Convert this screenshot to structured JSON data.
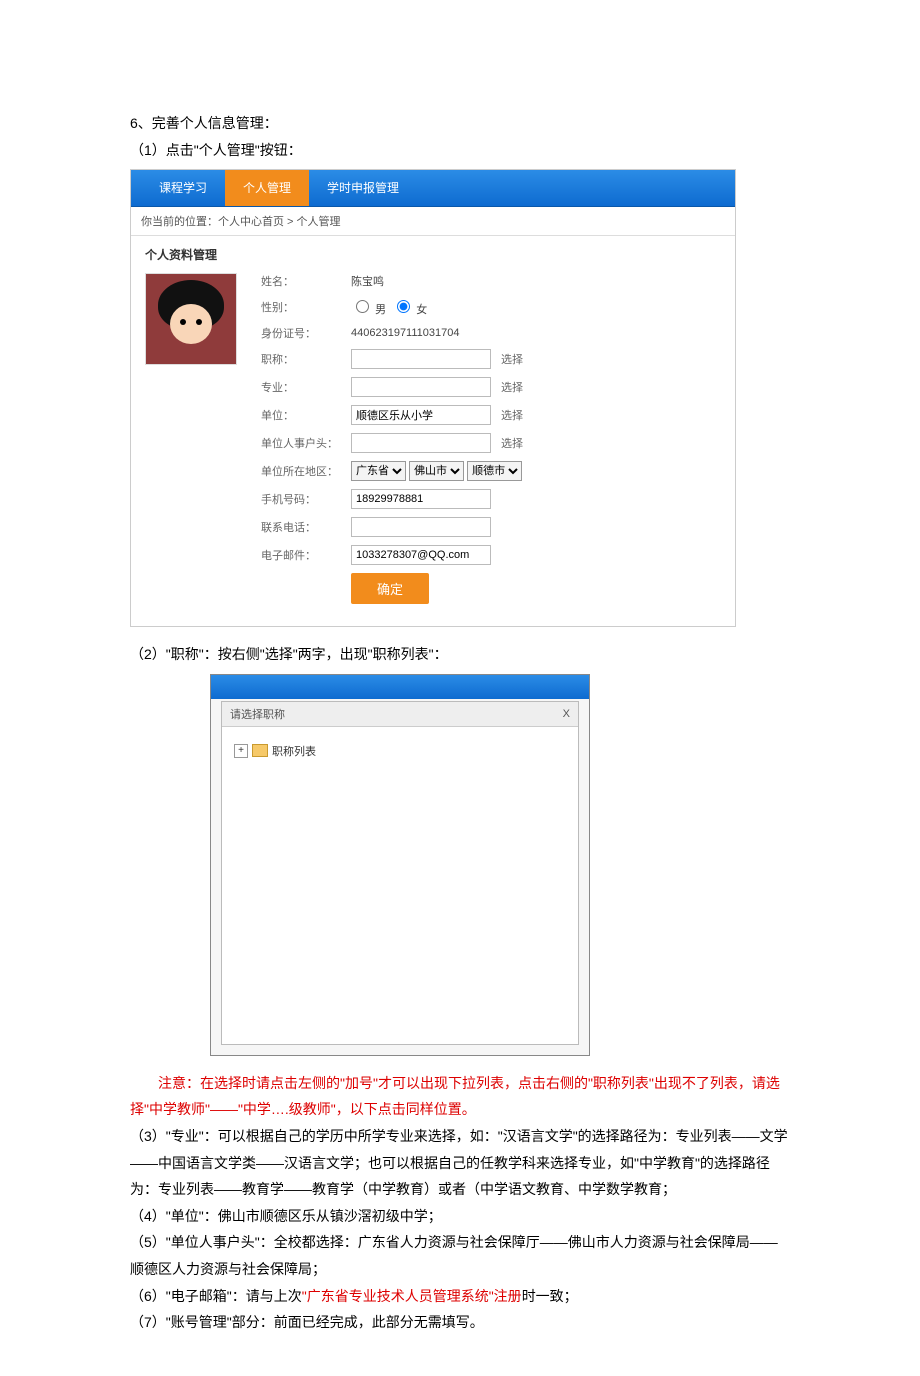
{
  "doc": {
    "step6": "6、完善个人信息管理：",
    "step6_1": "（1）点击\"个人管理\"按钮：",
    "step6_2": "（2）\"职称\"：按右侧\"选择\"两字，出现\"职称列表\"：",
    "note_head": "注意：在选择时请点击左侧的\"加号\"才可以出现下拉列表，点击右侧的\"职称列表\"出现不了列表，请选择\"中学教师\"——\"中学….级教师\"，以下点击同样位置。",
    "p3": "（3）\"专业\"：可以根据自己的学历中所学专业来选择，如：\"汉语言文学\"的选择路径为：专业列表——文学——中国语言文学类——汉语言文学；也可以根据自己的任教学科来选择专业，如\"中学教育\"的选择路径为：专业列表——教育学——教育学（中学教育）或者（中学语文教育、中学数学教育；",
    "p4": "（4）\"单位\"：佛山市顺德区乐从镇沙滘初级中学；",
    "p5": "（5）\"单位人事户头\"：全校都选择：广东省人力资源与社会保障厅——佛山市人力资源与社会保障局——顺德区人力资源与社会保障局；",
    "p6a": "（6）\"电子邮箱\"：请与上次",
    "p6b": "\"广东省专业技术人员管理系统\"注册",
    "p6c": "时一致；",
    "p7": "（7）\"账号管理\"部分：前面已经完成，此部分无需填写。"
  },
  "tabs": {
    "study": "课程学习",
    "personal": "个人管理",
    "apply": "学时申报管理"
  },
  "crumb": "你当前的位置：个人中心首页 > 个人管理",
  "section": "个人资料管理",
  "form": {
    "name_lbl": "姓名：",
    "name_val": "陈宝鸣",
    "gender_lbl": "性别：",
    "male": "男",
    "female": "女",
    "id_lbl": "身份证号：",
    "id_val": "440623197111031704",
    "title_lbl": "职称：",
    "major_lbl": "专业：",
    "unit_lbl": "单位：",
    "unit_val": "顺德区乐从小学",
    "hr_lbl": "单位人事户头：",
    "region_lbl": "单位所在地区：",
    "prov": "广东省",
    "city": "佛山市",
    "dist": "顺德市",
    "mobile_lbl": "手机号码：",
    "mobile_val": "18929978881",
    "phone_lbl": "联系电话：",
    "email_lbl": "电子邮件：",
    "email_val": "1033278307@QQ.com",
    "pick": "选择",
    "submit": "确定"
  },
  "modal": {
    "title": "请选择职称",
    "root": "职称列表",
    "close": "X"
  }
}
